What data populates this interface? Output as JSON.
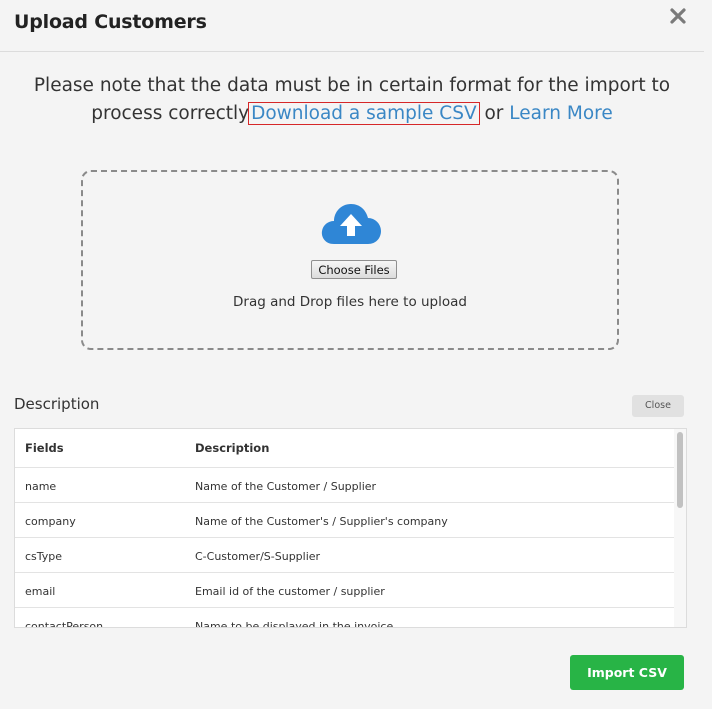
{
  "dialog": {
    "title": "Upload Customers"
  },
  "notice": {
    "text_before": "Please note that the data must be in certain format for the import to process correctly",
    "sample_link": "Download a sample CSV",
    "connector": " or ",
    "learn_more_link": "Learn More"
  },
  "dropzone": {
    "choose_files_label": "Choose Files",
    "drag_text": "Drag and Drop files here to upload",
    "icon": "cloud-upload-icon"
  },
  "description": {
    "title": "Description",
    "close_label": "Close",
    "columns": [
      "Fields",
      "Description"
    ],
    "rows": [
      {
        "field": "name",
        "description": "Name of the Customer / Supplier"
      },
      {
        "field": "company",
        "description": "Name of the Customer's / Supplier's company"
      },
      {
        "field": "csType",
        "description": "C-Customer/S-Supplier"
      },
      {
        "field": "email",
        "description": "Email id of the customer / supplier"
      },
      {
        "field": "contactPerson",
        "description": "Name to be displayed in the invoice"
      }
    ]
  },
  "footer": {
    "import_label": "Import CSV"
  },
  "colors": {
    "link": "#3a87c5",
    "primary_button": "#28b446",
    "icon_blue": "#2f86d6",
    "highlight_outline": "#d62728"
  }
}
